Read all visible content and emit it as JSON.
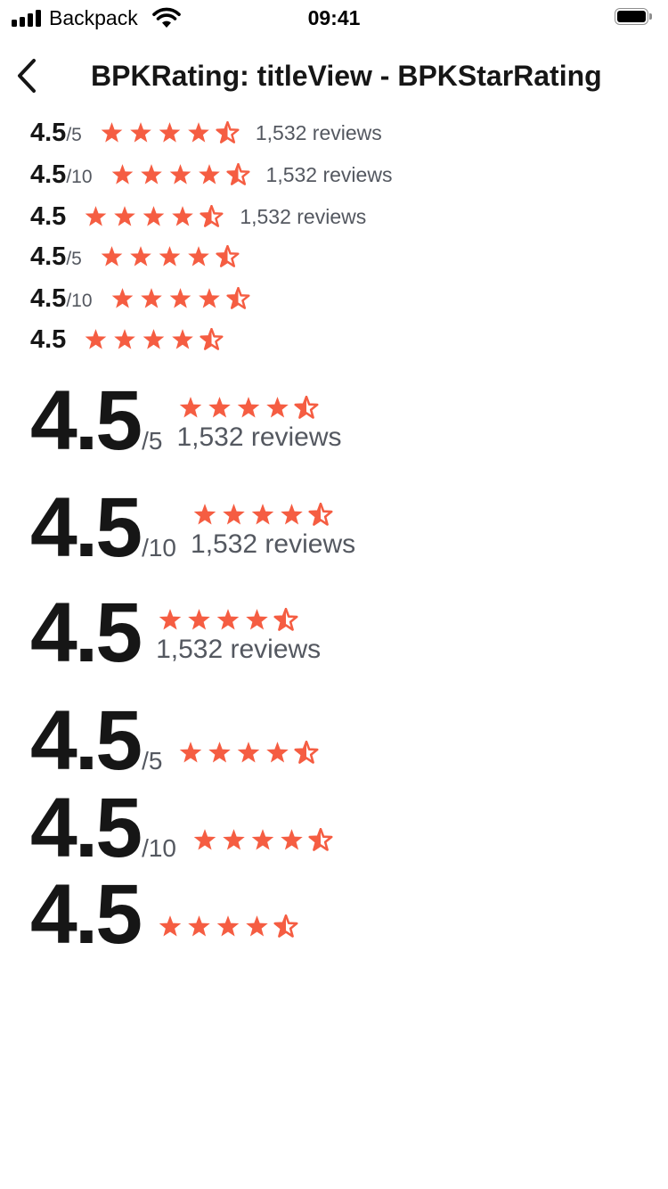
{
  "status_bar": {
    "carrier": "Backpack",
    "time": "09:41"
  },
  "nav": {
    "title": "BPKRating: titleView - BPKStarRating",
    "back_icon": "chevron-left-icon"
  },
  "colors": {
    "star": "#f55d42",
    "primary_text": "#161616",
    "secondary_text": "#545860"
  },
  "ratings": [
    {
      "value": "4.5",
      "scale": "/5",
      "reviews": "1,532 reviews",
      "size": "small",
      "stars": 4.5
    },
    {
      "value": "4.5",
      "scale": "/10",
      "reviews": "1,532 reviews",
      "size": "small",
      "stars": 4.5
    },
    {
      "value": "4.5",
      "scale": "",
      "reviews": "1,532 reviews",
      "size": "small",
      "stars": 4.5
    },
    {
      "value": "4.5",
      "scale": "/5",
      "reviews": "",
      "size": "small",
      "stars": 4.5
    },
    {
      "value": "4.5",
      "scale": "/10",
      "reviews": "",
      "size": "small",
      "stars": 4.5
    },
    {
      "value": "4.5",
      "scale": "",
      "reviews": "",
      "size": "small",
      "stars": 4.5
    },
    {
      "value": "4.5",
      "scale": "/5",
      "reviews": "1,532 reviews",
      "size": "large",
      "stars": 4.5
    },
    {
      "value": "4.5",
      "scale": "/10",
      "reviews": "1,532 reviews",
      "size": "large",
      "stars": 4.5
    },
    {
      "value": "4.5",
      "scale": "",
      "reviews": "1,532 reviews",
      "size": "large",
      "stars": 4.5
    },
    {
      "value": "4.5",
      "scale": "/5",
      "reviews": "",
      "size": "large",
      "stars": 4.5
    },
    {
      "value": "4.5",
      "scale": "/10",
      "reviews": "",
      "size": "large",
      "stars": 4.5
    },
    {
      "value": "4.5",
      "scale": "",
      "reviews": "",
      "size": "large",
      "stars": 4.5
    }
  ]
}
